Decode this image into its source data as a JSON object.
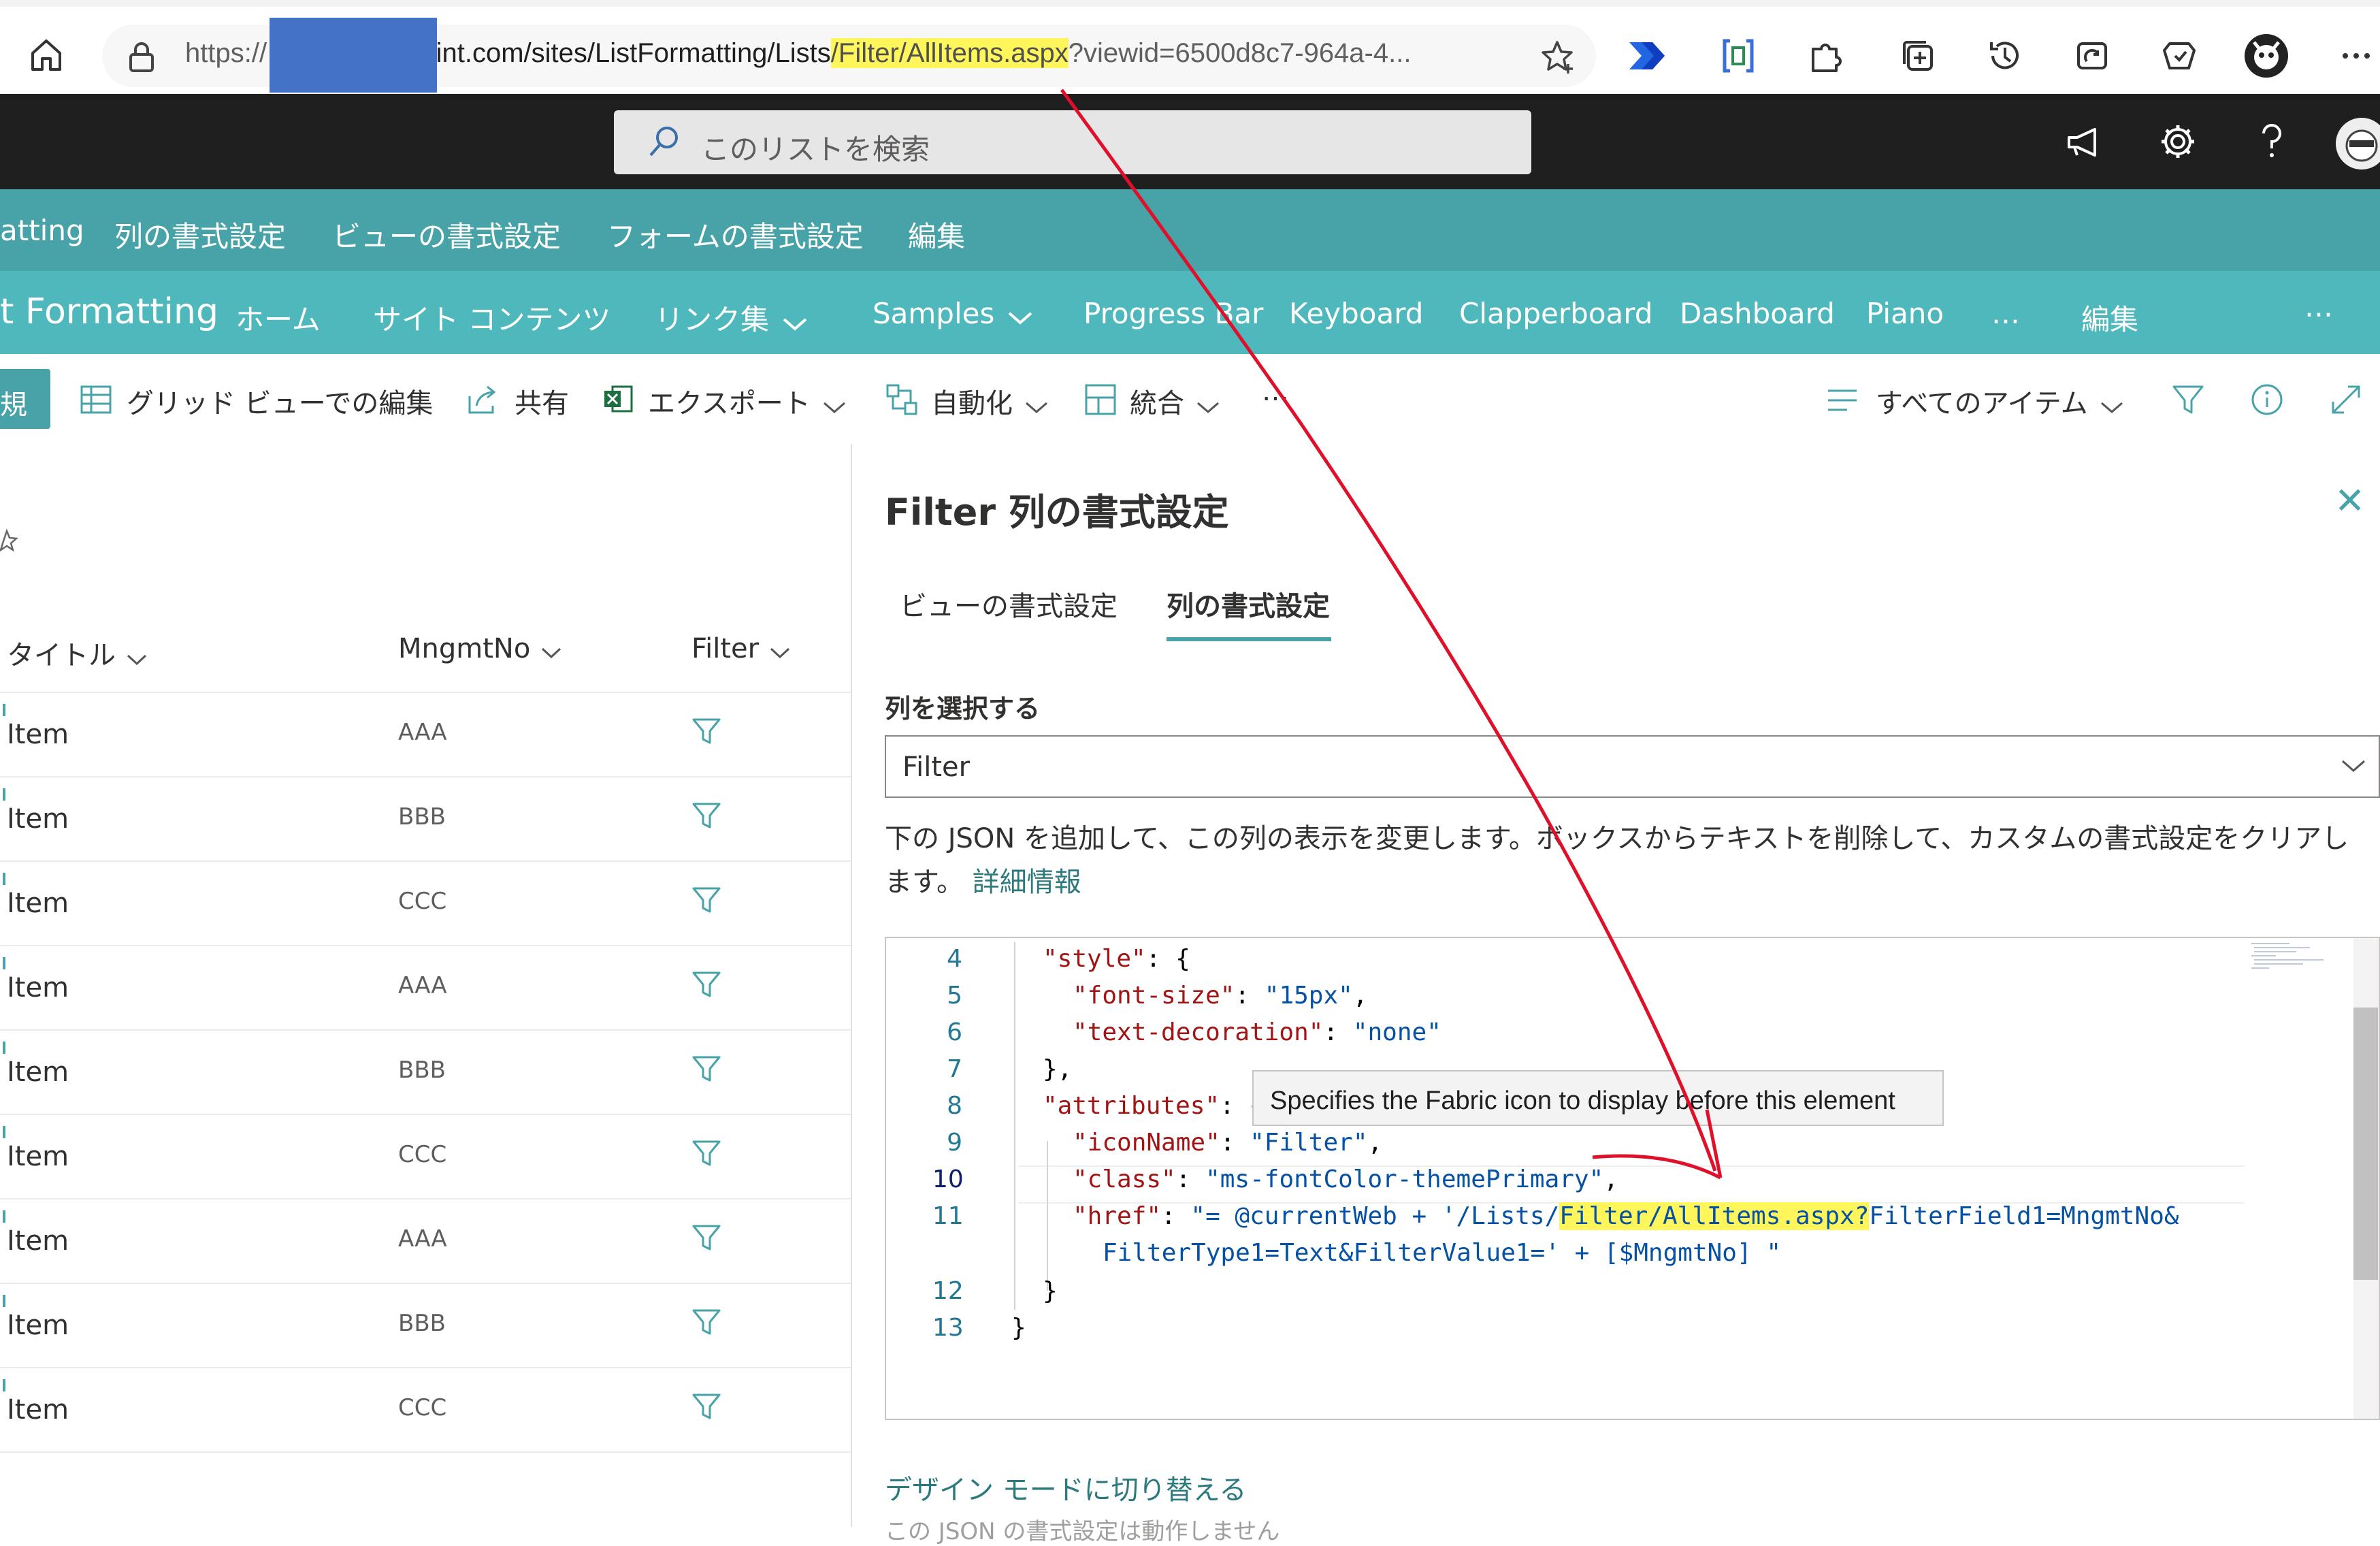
{
  "browser": {
    "url_prefix": "https://",
    "url_host": "harepoint.com/sites/ListFormatting/List",
    "url_s": "s",
    "url_path_highlight": "/Filter/AllItems.aspx",
    "url_query": "?viewid=6500d8c7-964a-4..."
  },
  "suite": {
    "search_placeholder": "このリストを検索"
  },
  "hub_nav": {
    "items": [
      "atting",
      "列の書式設定",
      "ビューの書式設定",
      "フォームの書式設定",
      "編集"
    ]
  },
  "site_nav": {
    "site_title": "t Formatting",
    "items": [
      "ホーム",
      "サイト コンテンツ",
      "リンク集",
      "Samples",
      "Progress Bar",
      "Keyboard",
      "Clapperboard",
      "Dashboard",
      "Piano",
      "…",
      "編集"
    ],
    "more": "…"
  },
  "command_bar": {
    "new_label": "規",
    "grid_edit": "グリッド ビューでの編集",
    "share": "共有",
    "export": "エクスポート",
    "automate": "自動化",
    "integrate": "統合",
    "more": "…",
    "view_name": "すべてのアイテム"
  },
  "list": {
    "col_title": "タイトル",
    "col_mngmtno": "MngmtNo",
    "col_filter": "Filter",
    "rows": [
      {
        "title": "Item",
        "mngmtno": "AAA"
      },
      {
        "title": "Item",
        "mngmtno": "BBB"
      },
      {
        "title": "Item",
        "mngmtno": "CCC"
      },
      {
        "title": "Item",
        "mngmtno": "AAA"
      },
      {
        "title": "Item",
        "mngmtno": "BBB"
      },
      {
        "title": "Item",
        "mngmtno": "CCC"
      },
      {
        "title": "Item",
        "mngmtno": "AAA"
      },
      {
        "title": "Item",
        "mngmtno": "BBB"
      },
      {
        "title": "Item",
        "mngmtno": "CCC"
      }
    ]
  },
  "panel": {
    "title": "Filter 列の書式設定",
    "tab_view": "ビューの書式設定",
    "tab_column": "列の書式設定",
    "select_label": "列を選択する",
    "select_value": "Filter",
    "description": "下の JSON を追加して、この列の表示を変更します。ボックスからテキストを削除して、カスタムの書式設定をクリアします。",
    "learn_more": "詳細情報",
    "design_mode": "デザイン モードに切り替える",
    "bottom_faint": "この JSON の書式設定は動作しません"
  },
  "code": {
    "line_numbers": [
      "4",
      "5",
      "6",
      "7",
      "8",
      "9",
      "10",
      "11",
      "12",
      "13"
    ],
    "l4_key": "\"style\"",
    "l4_rest": ": {",
    "l5_key": "\"font-size\"",
    "l5_sep": ": ",
    "l5_val": "\"15px\"",
    "l5_end": ",",
    "l6_key": "\"text-decoration\"",
    "l6_sep": ": ",
    "l6_val": "\"none\"",
    "l7": "},",
    "l8_key": "\"attributes\"",
    "l8_rest": ": {",
    "l9_key": "\"iconName\"",
    "l9_sep": ": ",
    "l9_val": "\"Filter\"",
    "l9_end": ",",
    "l10_key": "\"class\"",
    "l10_sep": ": ",
    "l10_val": "\"ms-fontColor-themePrimary\"",
    "l10_end": ",",
    "l11_key": "\"href\"",
    "l11_sep": ": ",
    "l11_val_a": "\"= @currentWeb + '/Lists/",
    "l11_val_hl": "Filter/AllItems.aspx?",
    "l11_val_b": "FilterField1=MngmtNo&",
    "l11_cont": "FilterType1=Text&FilterValue1=' + [$MngmtNo] \"",
    "l12": "}",
    "l13": "}",
    "tooltip": "Specifies the Fabric icon to display before this element"
  },
  "colors": {
    "hub": "#47a3a8",
    "site": "#4fb8bd",
    "suite": "#1f1f1f",
    "highlight": "#fef65b",
    "arrow": "#e0102a",
    "redaction": "#4472c4"
  }
}
